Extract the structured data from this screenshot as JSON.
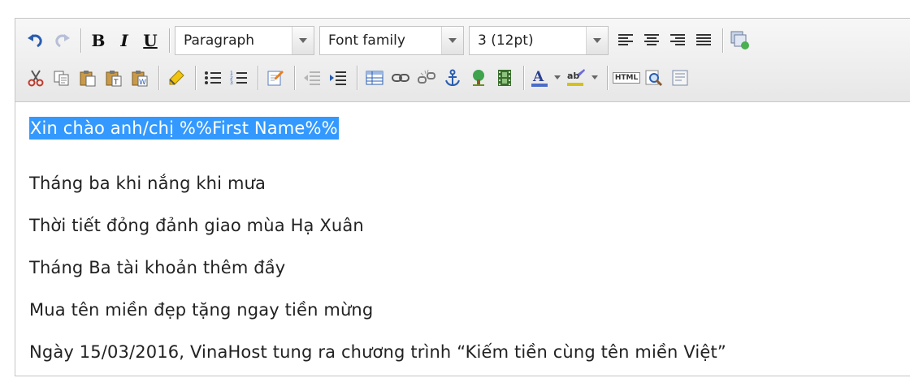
{
  "toolbar": {
    "row1": {
      "bold_label": "B",
      "italic_label": "I",
      "underline_label": "U",
      "format_select": "Paragraph",
      "font_family_select": "Font family",
      "font_size_select": "3 (12pt)"
    },
    "row2": {
      "font_color_label": "A",
      "highlight_label": "ab",
      "html_label": "HTML"
    }
  },
  "content": {
    "lines": [
      "Xin chào anh/chị %%First Name%%",
      "Tháng ba khi nắng khi mưa",
      "Thời tiết đỏng đảnh giao mùa Hạ Xuân",
      "Tháng Ba tài khoản thêm đầy",
      "Mua tên miền đẹp tặng ngay tiền mừng",
      "Ngày 15/03/2016, VinaHost tung ra chương trình “Kiếm tiền cùng tên miền Việt”"
    ]
  },
  "colors": {
    "selection": "#3399ff",
    "toolbar_bg": "#ececec",
    "text": "#222222"
  }
}
